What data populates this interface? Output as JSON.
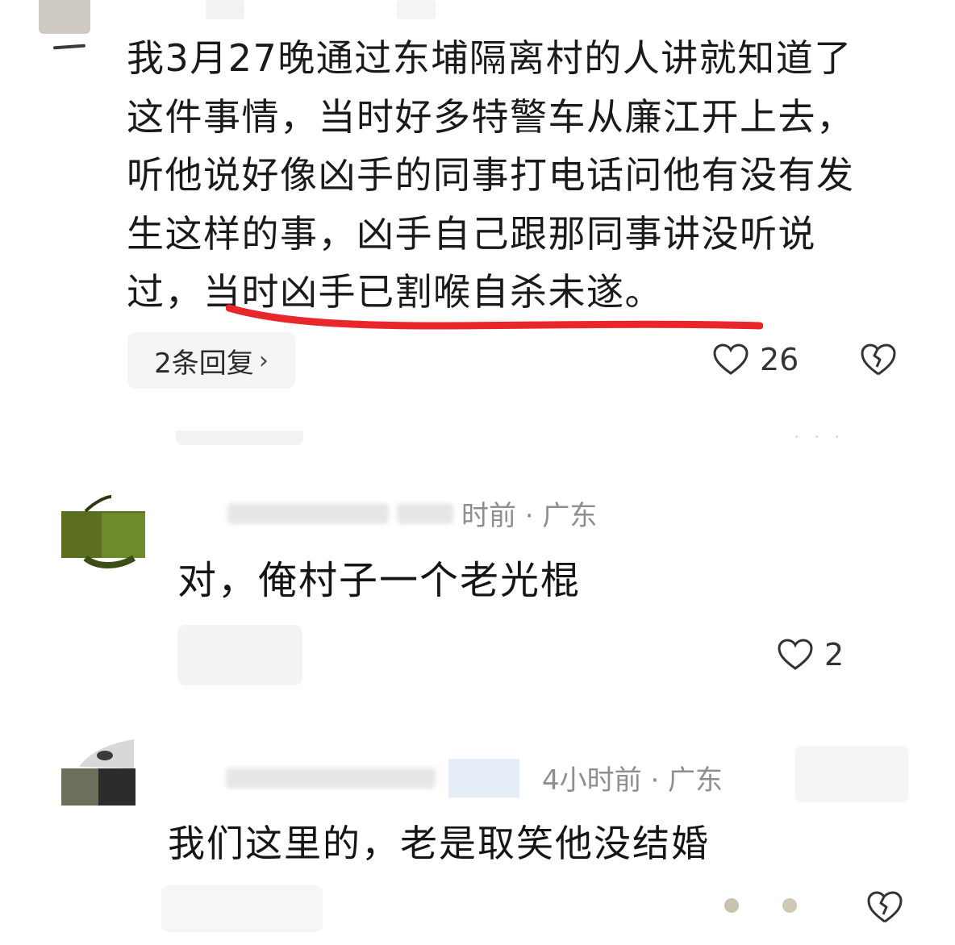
{
  "comment": {
    "text": "我3月27晚通过东埔隔离村的人讲就知道了\n这件事情，当时好多特警车从廉江开上去，\n听他说好像凶手的同事打电话问他有没有发\n生这样的事，凶手自己跟那同事讲没听说\n过，当时凶手已割喉自杀未遂。",
    "replies_label": "2条回复",
    "chevron_icon": "chevron-right-icon",
    "like_count": "26",
    "underline_color": "#e8262b"
  },
  "reply_one": {
    "meta_time": "时前 · 广东",
    "text": "对，俺村子一个老光棍",
    "like_count": "2"
  },
  "reply_two": {
    "meta_time": "4小时前 · 广东",
    "text": "我们这里的，老是取笑他没结婚"
  },
  "icons": {
    "like": "heart-outline-icon",
    "dislike": "broken-heart-icon"
  }
}
